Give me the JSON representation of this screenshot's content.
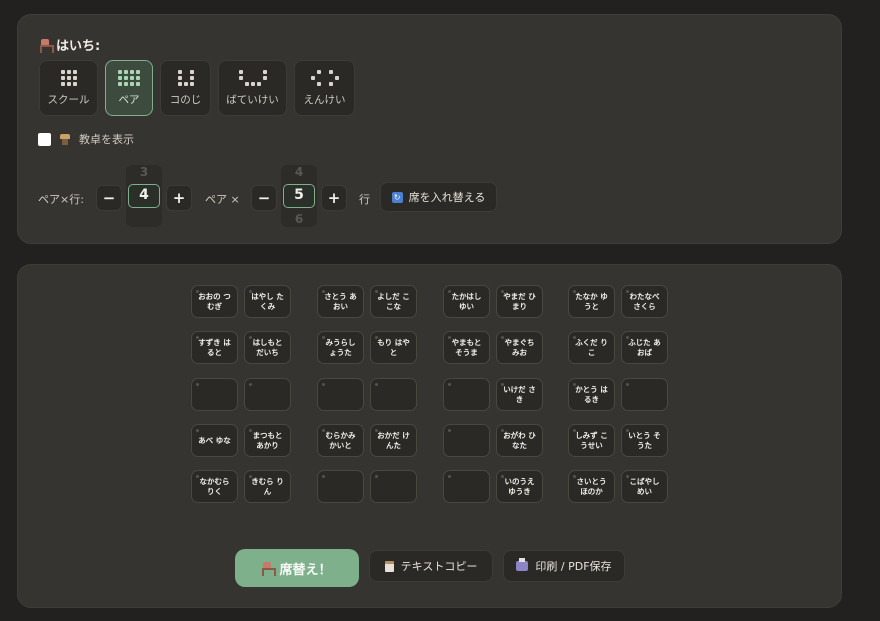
{
  "settings": {
    "layout_title": "はいち:",
    "layouts": [
      {
        "label": "スクール",
        "active": false
      },
      {
        "label": "ペア",
        "active": true
      },
      {
        "label": "コのじ",
        "active": false
      },
      {
        "label": "ばていけい",
        "active": false
      },
      {
        "label": "えんけい",
        "active": false
      }
    ],
    "show_desk_label": "教卓を表示",
    "show_desk_checked": false,
    "rows_label": "ペア×行:",
    "rows_value": "4",
    "rows_prev": "3",
    "pairs_label": "ペア ×",
    "pairs_value": "5",
    "pairs_prev": "4",
    "pairs_next": "6",
    "pairs_suffix": "行",
    "minus": "−",
    "plus": "+",
    "shuffle_label": "席を入れ替える",
    "shuffle_icon_glyph": "↻"
  },
  "seats": [
    [
      "おおの つむぎ",
      "はやし たくみ",
      "さとう あおい",
      "よしだ ここな",
      "たかはし ゆい",
      "やまだ ひまり",
      "たなか ゆうと",
      "わたなべ さくら"
    ],
    [
      "すずき はると",
      "はしもと だいち",
      "みうらし ょうた",
      "もり はやと",
      "やまもと そうま",
      "やまぐち みお",
      "ふくだ りこ",
      "ふじた あおば"
    ],
    [
      "",
      "",
      "",
      "",
      "",
      "いけだ さき",
      "かとう はるき",
      ""
    ],
    [
      "あべ ゆな",
      "まつもと あかり",
      "むらかみ かいと",
      "おかだ けんた",
      "",
      "おがわ ひなた",
      "しみず こうせい",
      "いとう そうた"
    ],
    [
      "なかむら りく",
      "きむら りん",
      "",
      "",
      "",
      "いのうえ ゆうき",
      "さいとう ほのか",
      "こばやし めい"
    ]
  ],
  "actions": {
    "go_label": "席替え！",
    "copy_label": "テキストコピー",
    "print_label": "印刷 / PDF保存"
  },
  "colors": {
    "background": "#222120",
    "panel": "#363430",
    "accent": "#7fb08c"
  }
}
